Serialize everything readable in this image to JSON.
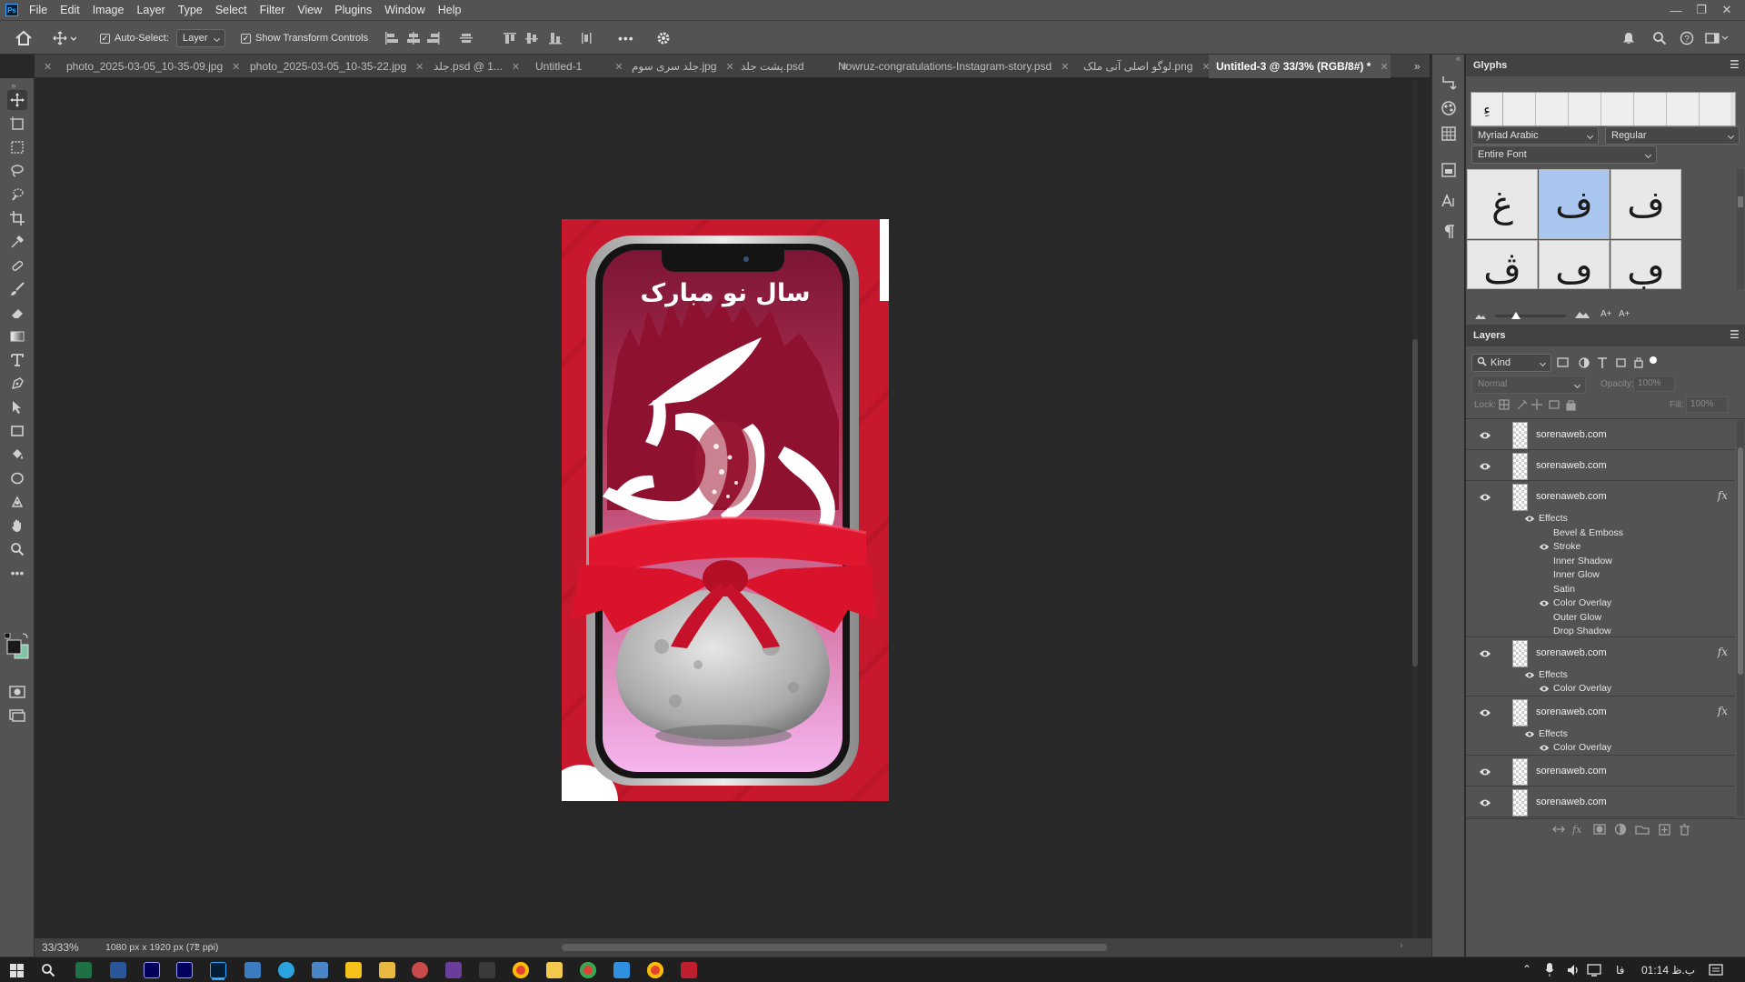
{
  "menubar": {
    "items": [
      "File",
      "Edit",
      "Image",
      "Layer",
      "Type",
      "Select",
      "Filter",
      "View",
      "Plugins",
      "Window",
      "Help"
    ],
    "app_logo": "Ps"
  },
  "options": {
    "auto_select_label": "Auto-Select:",
    "auto_select_checked": true,
    "layer_dropdown": "Layer",
    "show_transform_label": "Show Transform Controls",
    "show_transform_checked": true,
    "more": "•••"
  },
  "tabs": [
    {
      "label": "photo_2025-03-05_10-35-09.jpg",
      "active": false
    },
    {
      "label": "photo_2025-03-05_10-35-22.jpg",
      "active": false
    },
    {
      "label": "جلد.psd @ 1...",
      "active": false
    },
    {
      "label": "Untitled-1",
      "active": false
    },
    {
      "label": "جلد سری سوم.jpg",
      "active": false
    },
    {
      "label": "پشت جلد.psd",
      "active": false
    },
    {
      "label": "Nowruz-congratulations-Instagram-story.psd",
      "active": false
    },
    {
      "label": "لوگو اصلی آنی ملک.png",
      "active": false
    },
    {
      "label": "Untitled-3 @ 33/3% (RGB/8#) *",
      "active": true
    }
  ],
  "artwork": {
    "headline": "سال نو مبارک",
    "calligraphy": "بهار آمد",
    "colors": {
      "bg_red": "#c8182e",
      "screen_top": "#8a1d3a",
      "pink": "#f6b7f0",
      "ribbon": "#e0152e"
    }
  },
  "glyphs": {
    "title": "Glyphs",
    "recent": "ءِ",
    "font_family": "Myriad Arabic",
    "font_style": "Regular",
    "subset": "Entire Font",
    "cells": [
      "غ",
      "ف",
      "ف",
      "ڤ",
      "ڡ",
      "ڢ"
    ]
  },
  "layers": {
    "title": "Layers",
    "filter_kind": "Kind",
    "blend_mode": "Normal",
    "opacity_label": "Opacity:",
    "opacity_value": "100%",
    "lock_label": "Lock:",
    "fill_label": "Fill:",
    "fill_value": "100%",
    "rows": [
      {
        "name": "sorenaweb.com",
        "fx": false
      },
      {
        "name": "sorenaweb.com",
        "fx": false
      },
      {
        "name": "sorenaweb.com",
        "fx": true
      },
      {
        "name": "sorenaweb.com",
        "fx": true
      },
      {
        "name": "sorenaweb.com",
        "fx": true
      },
      {
        "name": "sorenaweb.com",
        "fx": false
      },
      {
        "name": "sorenaweb.com",
        "fx": false
      }
    ],
    "effects_label": "Effects",
    "effects_row3": [
      "Bevel & Emboss",
      "Stroke",
      "Inner Shadow",
      "Inner Glow",
      "Satin",
      "Color Overlay",
      "Outer Glow",
      "Drop Shadow"
    ],
    "color_overlay": "Color Overlay",
    "fx_label": "fx"
  },
  "status": {
    "zoom": "33/33%",
    "doc_info": "1080 px x 1920 px (72 ppi)"
  },
  "taskbar": {
    "clock": "01:14 ب.ظ",
    "lang": "فا"
  }
}
